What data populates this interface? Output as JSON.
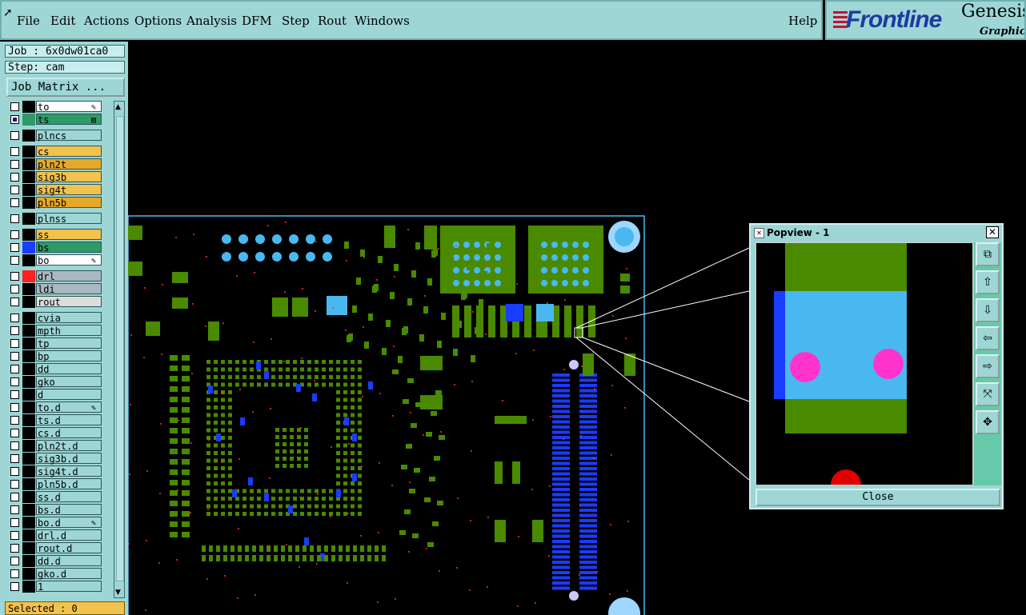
{
  "menu": {
    "items": [
      "File",
      "Edit",
      "Actions",
      "Options",
      "Analysis",
      "DFM",
      "Step",
      "Rout",
      "Windows"
    ],
    "help": "Help"
  },
  "logo": {
    "brand": "Frontline",
    "product": "Genesis",
    "subtitle": "Graphic E"
  },
  "job": {
    "label": "Job : 6x0dw01ca0",
    "step": "Step: cam",
    "matrix_button": "Job Matrix ..."
  },
  "layers": [
    {
      "name": "to",
      "bg": "#ffffff",
      "color": "#000000",
      "mark": "✎",
      "group": 1
    },
    {
      "name": "ts",
      "bg": "#2e9a68",
      "color": "#2e9a68",
      "mark": "▤",
      "group": 1,
      "checked": true
    },
    {
      "name": "plncs",
      "bg": "#9ed6d6",
      "color": "#000000",
      "mark": "",
      "group": 2
    },
    {
      "name": "cs",
      "bg": "#f2c24e",
      "color": "#000000",
      "mark": "",
      "group": 3
    },
    {
      "name": "pln2t",
      "bg": "#e6a82a",
      "color": "#000000",
      "mark": "",
      "group": 3
    },
    {
      "name": "sig3b",
      "bg": "#f2c24e",
      "color": "#000000",
      "mark": "",
      "group": 3
    },
    {
      "name": "sig4t",
      "bg": "#f2c24e",
      "color": "#000000",
      "mark": "",
      "group": 3
    },
    {
      "name": "pln5b",
      "bg": "#e6a82a",
      "color": "#000000",
      "mark": "",
      "group": 3
    },
    {
      "name": "plnss",
      "bg": "#9ed6d6",
      "color": "#000000",
      "mark": "",
      "group": 4
    },
    {
      "name": "ss",
      "bg": "#f2c24e",
      "color": "#000000",
      "mark": "",
      "group": 5
    },
    {
      "name": "bs",
      "bg": "#2e9a68",
      "color": "#1a3cff",
      "mark": "",
      "group": 5
    },
    {
      "name": "bo",
      "bg": "#ffffff",
      "color": "#000000",
      "mark": "✎",
      "group": 5
    },
    {
      "name": "drl",
      "bg": "#a9b8c0",
      "color": "#ff2020",
      "mark": "",
      "group": 6
    },
    {
      "name": "ldi",
      "bg": "#a9b8c0",
      "color": "#000000",
      "mark": "",
      "group": 6
    },
    {
      "name": "rout",
      "bg": "#dcdcdc",
      "color": "#000000",
      "mark": "",
      "group": 6
    },
    {
      "name": "cvia",
      "bg": "#9ed6d6",
      "color": "#000000",
      "mark": "",
      "group": 7
    },
    {
      "name": "mpth",
      "bg": "#9ed6d6",
      "color": "#000000",
      "mark": "",
      "group": 7
    },
    {
      "name": "tp",
      "bg": "#9ed6d6",
      "color": "#000000",
      "mark": "",
      "group": 7
    },
    {
      "name": "bp",
      "bg": "#9ed6d6",
      "color": "#000000",
      "mark": "",
      "group": 7
    },
    {
      "name": "dd",
      "bg": "#9ed6d6",
      "color": "#000000",
      "mark": "",
      "group": 7
    },
    {
      "name": "gko",
      "bg": "#9ed6d6",
      "color": "#000000",
      "mark": "",
      "group": 7
    },
    {
      "name": "d",
      "bg": "#9ed6d6",
      "color": "#000000",
      "mark": "",
      "group": 7
    },
    {
      "name": "to.d",
      "bg": "#9ed6d6",
      "color": "#000000",
      "mark": "✎",
      "group": 7
    },
    {
      "name": "ts.d",
      "bg": "#9ed6d6",
      "color": "#000000",
      "mark": "",
      "group": 7
    },
    {
      "name": "cs.d",
      "bg": "#9ed6d6",
      "color": "#000000",
      "mark": "",
      "group": 7
    },
    {
      "name": "pln2t.d",
      "bg": "#9ed6d6",
      "color": "#000000",
      "mark": "",
      "group": 7
    },
    {
      "name": "sig3b.d",
      "bg": "#9ed6d6",
      "color": "#000000",
      "mark": "",
      "group": 7
    },
    {
      "name": "sig4t.d",
      "bg": "#9ed6d6",
      "color": "#000000",
      "mark": "",
      "group": 7
    },
    {
      "name": "pln5b.d",
      "bg": "#9ed6d6",
      "color": "#000000",
      "mark": "",
      "group": 7
    },
    {
      "name": "ss.d",
      "bg": "#9ed6d6",
      "color": "#000000",
      "mark": "",
      "group": 7
    },
    {
      "name": "bs.d",
      "bg": "#9ed6d6",
      "color": "#000000",
      "mark": "",
      "group": 7
    },
    {
      "name": "bo.d",
      "bg": "#9ed6d6",
      "color": "#000000",
      "mark": "✎",
      "group": 7
    },
    {
      "name": "drl.d",
      "bg": "#9ed6d6",
      "color": "#000000",
      "mark": "",
      "group": 7
    },
    {
      "name": "rout.d",
      "bg": "#9ed6d6",
      "color": "#000000",
      "mark": "",
      "group": 7
    },
    {
      "name": "dd.d",
      "bg": "#9ed6d6",
      "color": "#000000",
      "mark": "",
      "group": 7
    },
    {
      "name": "gko.d",
      "bg": "#9ed6d6",
      "color": "#000000",
      "mark": "",
      "group": 7
    },
    {
      "name": "1",
      "bg": "#9ed6d6",
      "color": "#000000",
      "mark": "",
      "group": 7
    }
  ],
  "status": {
    "selected": "Selected : 0"
  },
  "popview": {
    "title": "Popview - 1",
    "close_label": "Close",
    "tools": [
      "zoom-window-icon",
      "pan-up-icon",
      "pan-down-icon",
      "pan-left-icon",
      "pan-right-icon",
      "zoom-out-icon",
      "zoom-in-icon"
    ]
  },
  "colors": {
    "panel": "#9ed6d6",
    "pad_green": "#4a8a00",
    "pad_blue": "#1a3cff",
    "pad_cyan": "#4ab8f0",
    "drill": "#ff33cc"
  }
}
